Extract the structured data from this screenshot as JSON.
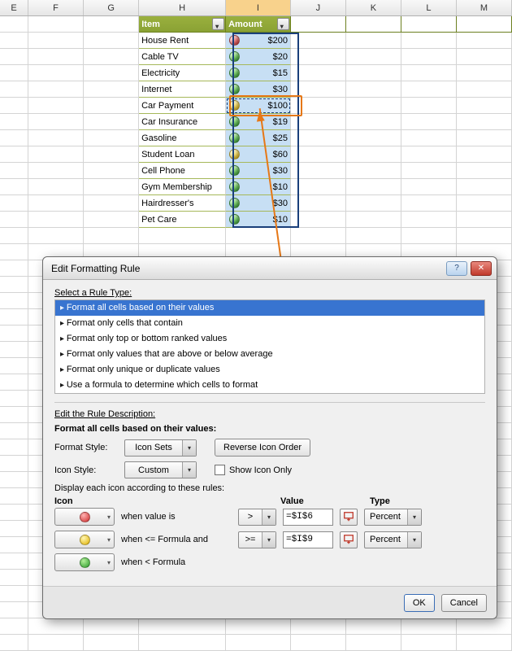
{
  "columns": [
    "E",
    "F",
    "G",
    "H",
    "I",
    "J",
    "K",
    "L",
    "M"
  ],
  "table": {
    "headers": {
      "item": "Item",
      "amount": "Amount"
    },
    "rows": [
      {
        "item": "House Rent",
        "amount": "$200",
        "icon": "red"
      },
      {
        "item": "Cable TV",
        "amount": "$20",
        "icon": "green"
      },
      {
        "item": "Electricity",
        "amount": "$15",
        "icon": "green"
      },
      {
        "item": "Internet",
        "amount": "$30",
        "icon": "green"
      },
      {
        "item": "Car Payment",
        "amount": "$100",
        "icon": "yellow"
      },
      {
        "item": "Car Insurance",
        "amount": "$19",
        "icon": "green"
      },
      {
        "item": "Gasoline",
        "amount": "$25",
        "icon": "green"
      },
      {
        "item": "Student Loan",
        "amount": "$60",
        "icon": "yellow"
      },
      {
        "item": "Cell Phone",
        "amount": "$30",
        "icon": "green"
      },
      {
        "item": "Gym Membership",
        "amount": "$10",
        "icon": "green"
      },
      {
        "item": "Hairdresser's",
        "amount": "$30",
        "icon": "green"
      },
      {
        "item": "Pet Care",
        "amount": "$10",
        "icon": "green"
      }
    ]
  },
  "dialog": {
    "title": "Edit Formatting Rule",
    "select_label": "Select a Rule Type:",
    "ruleTypes": [
      "Format all cells based on their values",
      "Format only cells that contain",
      "Format only top or bottom ranked values",
      "Format only values that are above or below average",
      "Format only unique or duplicate values",
      "Use a formula to determine which cells to format"
    ],
    "editDesc": "Edit the Rule Description:",
    "formatAll": "Format all cells based on their values:",
    "formatStyleLabel": "Format Style:",
    "formatStyle": "Icon Sets",
    "reverse": "Reverse Icon Order",
    "iconStyleLabel": "Icon Style:",
    "iconStyle": "Custom",
    "showIconOnly": "Show Icon Only",
    "displayEach": "Display each icon according to these rules:",
    "colIcon": "Icon",
    "colValue": "Value",
    "colType": "Type",
    "r1": {
      "when": "when value is",
      "op": ">",
      "value": "=$I$6",
      "type": "Percent"
    },
    "r2": {
      "when": "when <= Formula and",
      "op": ">=",
      "value": "=$I$9",
      "type": "Percent"
    },
    "r3": {
      "when": "when < Formula"
    },
    "ok": "OK",
    "cancel": "Cancel"
  }
}
